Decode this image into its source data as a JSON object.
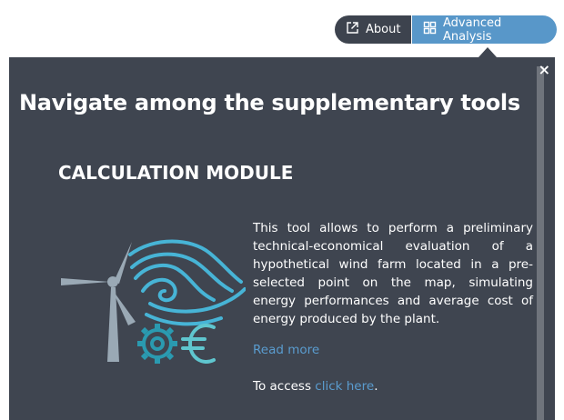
{
  "toolbar": {
    "about_label": "About",
    "advanced_label": "Advanced Analysis"
  },
  "icons": {
    "about": "external-link-icon",
    "advanced": "grid-icon",
    "close": "close-icon"
  },
  "panel": {
    "close_symbol": "×",
    "heading": "Navigate among the supplementary tools",
    "module_title": "CALCULATION MODULE",
    "description": "This tool allows to perform a preliminary technical-economical evaluation of a hypothetical wind farm located in a pre-selected point on the map, simulating energy performances and average cost of energy produced by the plant.",
    "read_more": "Read more",
    "access_prefix": "To access ",
    "access_link": "click here",
    "access_suffix": "."
  },
  "colors": {
    "panel_bg": "#3f4550",
    "about_bg": "#3d434e",
    "advanced_bg": "#5897c9",
    "link": "#5a9ccf",
    "turbine": "#9aa9b5",
    "wind": "#47b4d6",
    "gear": "#2a9ab0",
    "euro": "#5fc6cf"
  }
}
